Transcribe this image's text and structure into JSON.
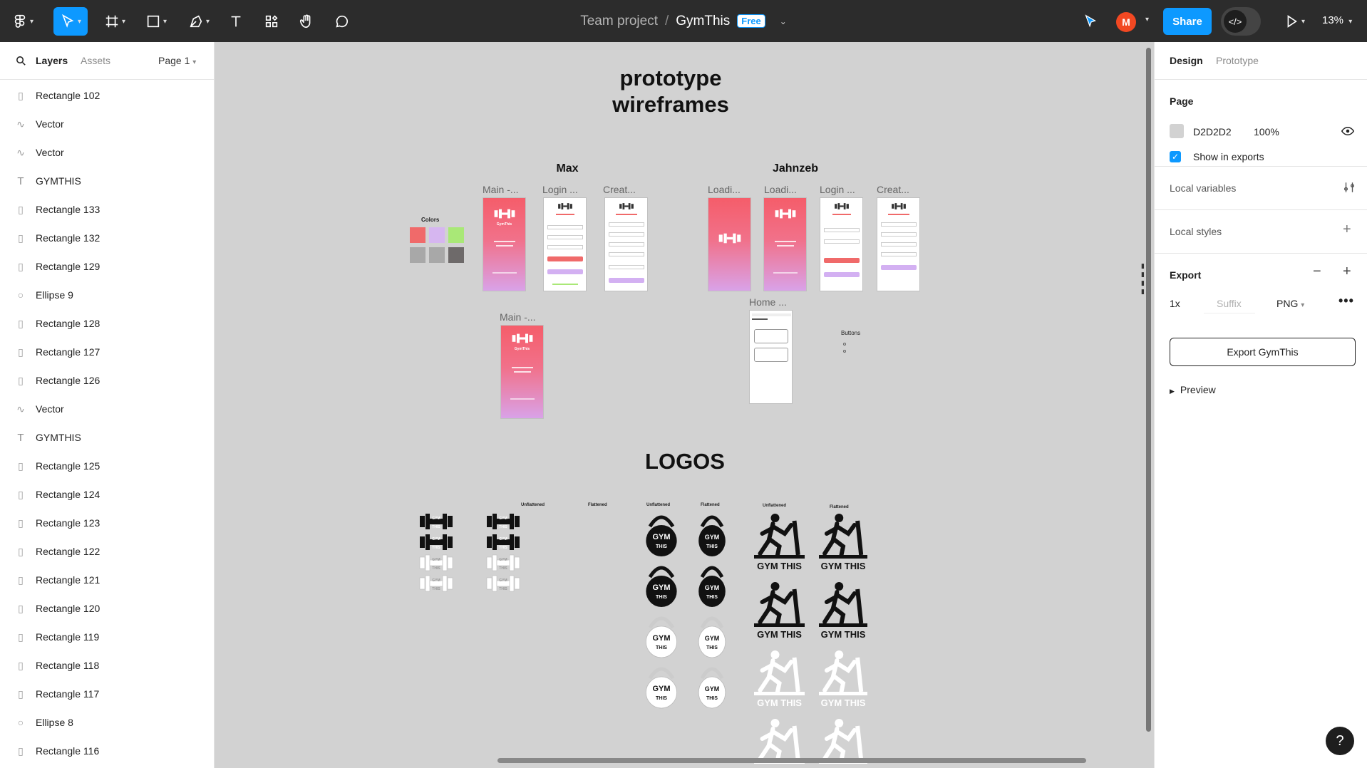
{
  "toolbar": {
    "breadcrumb_team": "Team project",
    "breadcrumb_sep": "/",
    "file_name": "GymThis",
    "plan_badge": "Free",
    "share_label": "Share",
    "avatar_initial": "M",
    "zoom_label": "13%",
    "devmode_label": "</>",
    "tools": [
      "main-menu-icon",
      "move-icon",
      "frame-icon",
      "shape-icon",
      "pen-icon",
      "text-icon",
      "resources-icon",
      "hand-icon",
      "comment-icon"
    ]
  },
  "left_panel": {
    "tab_layers": "Layers",
    "tab_assets": "Assets",
    "page_selector": "Page 1",
    "layers": [
      {
        "icon": "rect",
        "name": "Rectangle 102"
      },
      {
        "icon": "vector",
        "name": "Vector"
      },
      {
        "icon": "vector",
        "name": "Vector"
      },
      {
        "icon": "text",
        "name": "GYMTHIS"
      },
      {
        "icon": "rect",
        "name": "Rectangle 133"
      },
      {
        "icon": "rect",
        "name": "Rectangle 132"
      },
      {
        "icon": "rect",
        "name": "Rectangle 129"
      },
      {
        "icon": "ellipse",
        "name": "Ellipse 9"
      },
      {
        "icon": "rect",
        "name": "Rectangle 128"
      },
      {
        "icon": "rect",
        "name": "Rectangle 127"
      },
      {
        "icon": "rect",
        "name": "Rectangle 126"
      },
      {
        "icon": "vector",
        "name": "Vector"
      },
      {
        "icon": "text",
        "name": "GYMTHIS"
      },
      {
        "icon": "rect",
        "name": "Rectangle 125"
      },
      {
        "icon": "rect",
        "name": "Rectangle 124"
      },
      {
        "icon": "rect",
        "name": "Rectangle 123"
      },
      {
        "icon": "rect",
        "name": "Rectangle 122"
      },
      {
        "icon": "rect",
        "name": "Rectangle 121"
      },
      {
        "icon": "rect",
        "name": "Rectangle 120"
      },
      {
        "icon": "rect",
        "name": "Rectangle 119"
      },
      {
        "icon": "rect",
        "name": "Rectangle 118"
      },
      {
        "icon": "rect",
        "name": "Rectangle 117"
      },
      {
        "icon": "ellipse",
        "name": "Ellipse 8"
      },
      {
        "icon": "rect",
        "name": "Rectangle 116"
      }
    ]
  },
  "canvas": {
    "heading_line1": "prototype",
    "heading_line2": "wireframes",
    "group_max": "Max",
    "group_jahnzeb": "Jahnzeb",
    "colors_label": "Colors",
    "color_swatches": [
      "#f06a6a",
      "#d6b6f0",
      "#a9e877",
      "#a8a8a8",
      "#a8a8a8",
      "#6e6a6a"
    ],
    "frames_max": [
      "Main -...",
      "Login ...",
      "Creat..."
    ],
    "frames_jahnzeb": [
      "Loadi...",
      "Loadi...",
      "Login ...",
      "Creat..."
    ],
    "frame_main2": "Main -...",
    "frame_home": "Home ...",
    "buttons_label": "Buttons",
    "logos_heading": "LOGOS",
    "logo_labels": [
      "Unflattened",
      "Flattened",
      "Unflattened",
      "Flattened",
      "Unflattened",
      "Flattened"
    ],
    "logo_text_gym": "GYM",
    "logo_text_this": "THIS",
    "logo_text_gymthis": "GYM THIS",
    "app_name": "GymThis"
  },
  "right_panel": {
    "tab_design": "Design",
    "tab_prototype": "Prototype",
    "page_section": "Page",
    "page_color": "D2D2D2",
    "page_opacity": "100%",
    "show_in_exports": "Show in exports",
    "local_variables": "Local variables",
    "local_styles": "Local styles",
    "export_section": "Export",
    "export_scale": "1x",
    "export_suffix_placeholder": "Suffix",
    "export_format": "PNG",
    "export_button": "Export GymThis",
    "preview_label": "Preview"
  },
  "colors": {
    "accent": "#0d99ff",
    "toolbar_bg": "#2c2c2c",
    "canvas_bg": "#d2d2d2"
  }
}
